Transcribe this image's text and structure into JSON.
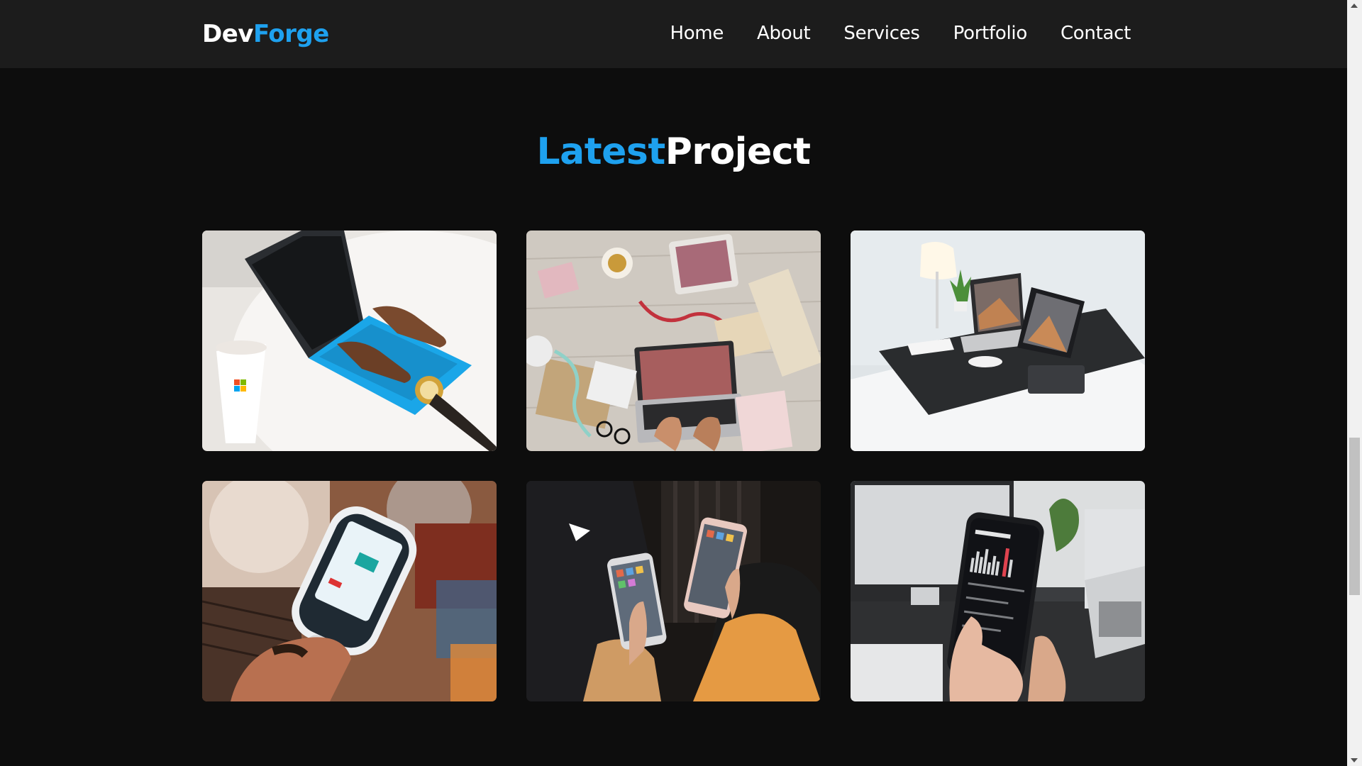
{
  "brand": {
    "logo_part1": "Dev",
    "logo_part2": "Forge",
    "accent_color": "#1ea1ef"
  },
  "nav": {
    "items": [
      "Home",
      "About",
      "Services",
      "Portfolio",
      "Contact"
    ]
  },
  "section": {
    "title_part1": "Latest",
    "title_part2": "Project"
  },
  "projects": [
    {
      "name": "laptop-typing-blue-keyboard"
    },
    {
      "name": "flatlay-laptop-tablet-desk"
    },
    {
      "name": "desk-laptop-tablet-lamp"
    },
    {
      "name": "handheld-scanner-device"
    },
    {
      "name": "two-smartphones-hands"
    },
    {
      "name": "earthquake-app-phone"
    }
  ],
  "colors": {
    "background": "#0d0d0d",
    "navbar": "#1c1c1c",
    "text": "#ffffff"
  }
}
